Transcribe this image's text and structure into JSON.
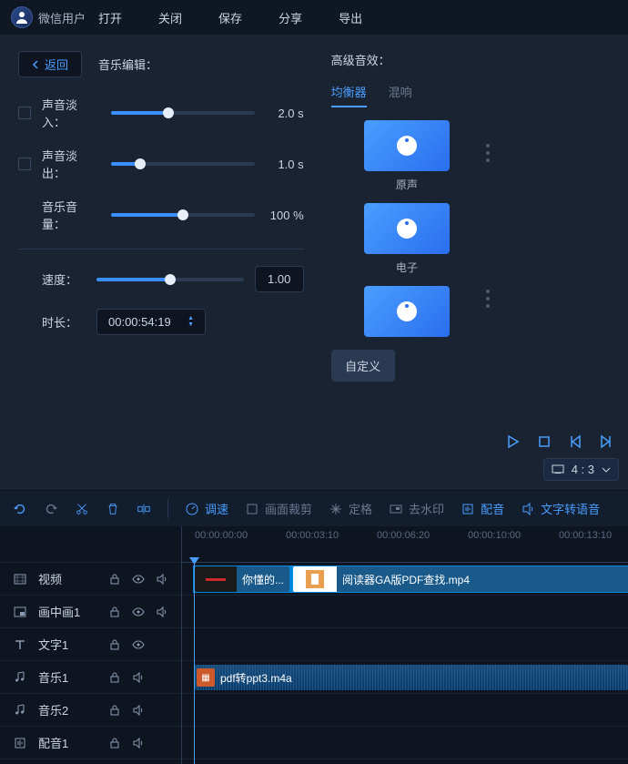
{
  "topbar": {
    "username": "微信用户",
    "menu": [
      "打开",
      "关闭",
      "保存",
      "分享",
      "导出"
    ]
  },
  "editor": {
    "back": "返回",
    "title": "音乐编辑：",
    "fadeIn": {
      "label": "声音淡入：",
      "value": "2.0 s",
      "pct": 40
    },
    "fadeOut": {
      "label": "声音淡出：",
      "value": "1.0 s",
      "pct": 20
    },
    "volume": {
      "label": "音乐音量：",
      "value": "100 %",
      "pct": 50
    },
    "speed": {
      "label": "速度：",
      "value": "1.00",
      "pct": 50
    },
    "duration": {
      "label": "时长：",
      "value": "00:00:54:19"
    }
  },
  "effects": {
    "title": "高级音效：",
    "tabs": [
      "均衡器",
      "混响"
    ],
    "activeTab": 0,
    "presets": [
      "原声",
      "电子",
      ""
    ],
    "custom": "自定义"
  },
  "playback": {
    "aspect": "4 : 3"
  },
  "toolbar": {
    "speed": "调速",
    "crop": "画面裁剪",
    "freeze": "定格",
    "watermark": "去水印",
    "dub": "配音",
    "tts": "文字转语音"
  },
  "timeline": {
    "ticks": [
      "00:00:00:00",
      "00:00:03:10",
      "00:00:06:20",
      "00:00:10:00",
      "00:00:13:10"
    ],
    "tracks": [
      {
        "name": "视频"
      },
      {
        "name": "画中画1"
      },
      {
        "name": "文字1"
      },
      {
        "name": "音乐1"
      },
      {
        "name": "音乐2"
      },
      {
        "name": "配音1"
      }
    ],
    "clip1": "你懂的...",
    "clip2": "阅读器GA版PDF查找.mp4",
    "audioClip": "pdf转ppt3.m4a"
  }
}
